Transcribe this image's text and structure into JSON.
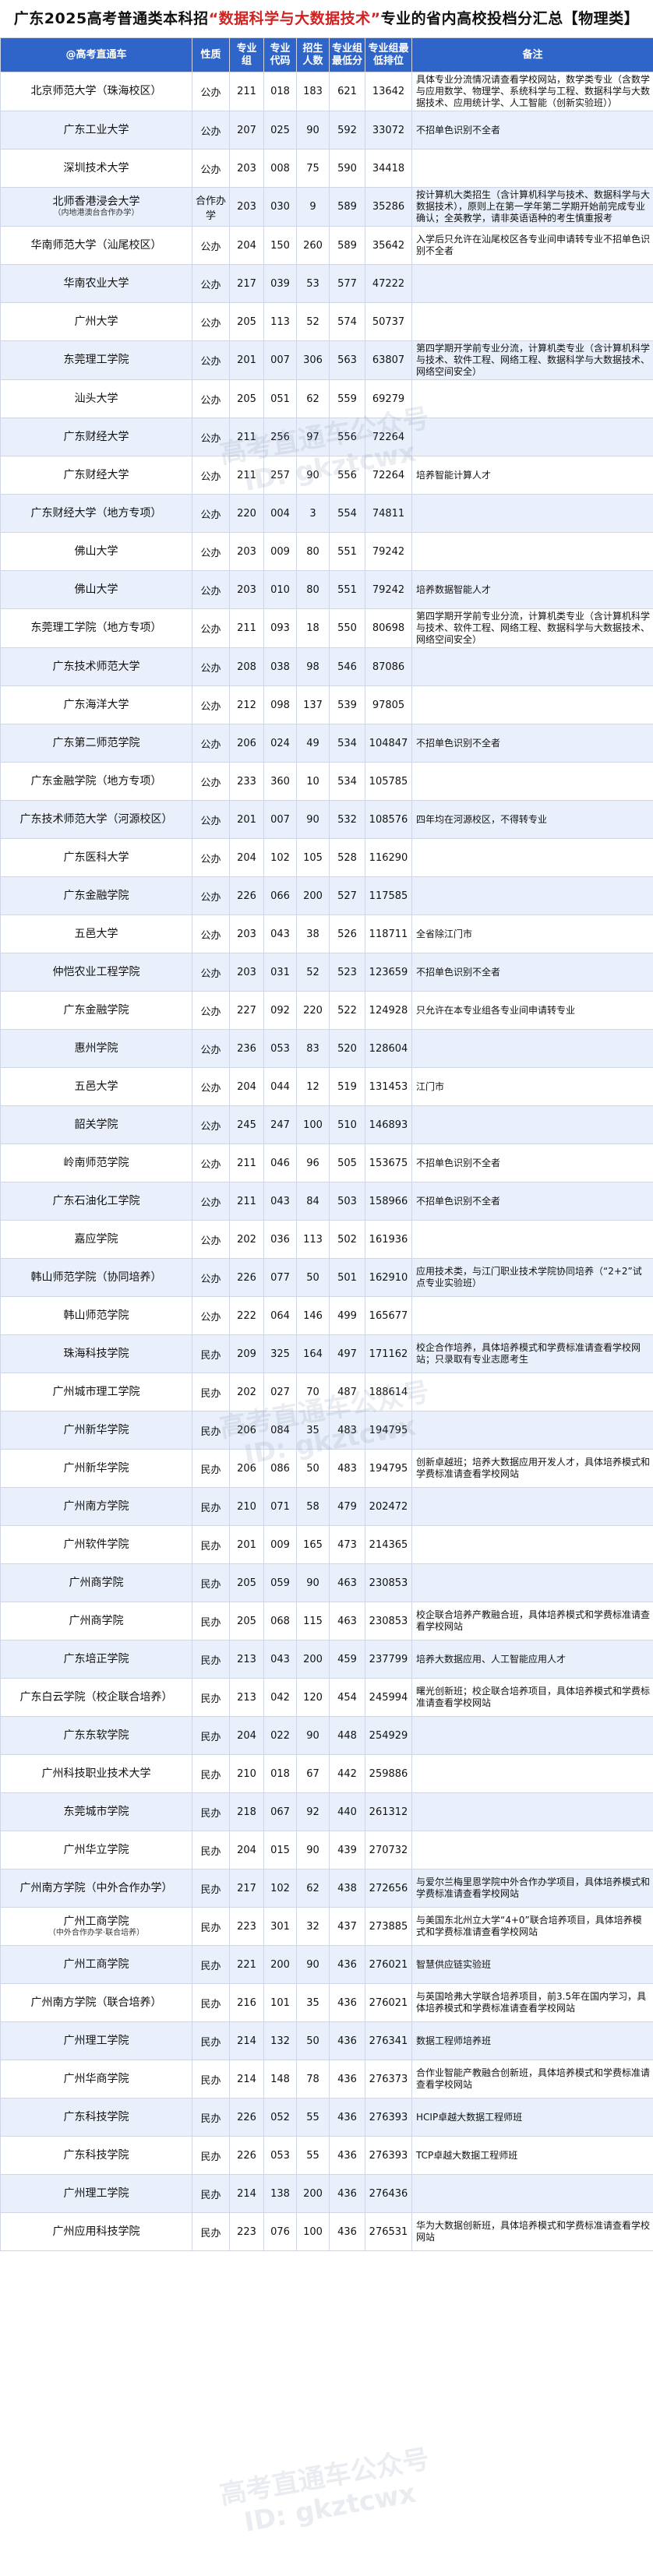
{
  "title": {
    "prefix": "广东2025高考普通类本科招",
    "highlight": "“数据科学与大数据技术”",
    "suffix": "专业的省内高校投档分汇总【物理类】"
  },
  "columns": [
    "@高考直通车",
    "性质",
    "专业组",
    "专业代码",
    "招生人数",
    "专业组最低分",
    "专业组最低排位",
    "备注"
  ],
  "watermark": [
    "高考直通车公众号",
    "ID: gkztcwx"
  ],
  "rows": [
    {
      "school": "北京师范大学（珠海校区）",
      "sub": "",
      "type": "公办",
      "group": "211",
      "code": "018",
      "count": "183",
      "score": "621",
      "rank": "13642",
      "note": "具体专业分流情况请查看学校网站，数学类专业（含数学与应用数学、物理学、系统科学与工程、数据科学与大数据技术、应用统计学、人工智能（创新实验班））"
    },
    {
      "school": "广东工业大学",
      "sub": "",
      "type": "公办",
      "group": "207",
      "code": "025",
      "count": "90",
      "score": "592",
      "rank": "33072",
      "note": "不招单色识别不全者"
    },
    {
      "school": "深圳技术大学",
      "sub": "",
      "type": "公办",
      "group": "203",
      "code": "008",
      "count": "75",
      "score": "590",
      "rank": "34418",
      "note": ""
    },
    {
      "school": "北师香港浸会大学",
      "sub": "（内地港澳台合作办学）",
      "type": "合作办学",
      "group": "203",
      "code": "030",
      "count": "9",
      "score": "589",
      "rank": "35286",
      "note": "按计算机大类招生（含计算机科学与技术、数据科学与大数据技术），原则上在第一学年第二学期开始前完成专业确认；全英教学，请非英语语种的考生慎重报考"
    },
    {
      "school": "华南师范大学（汕尾校区）",
      "sub": "",
      "type": "公办",
      "group": "204",
      "code": "150",
      "count": "260",
      "score": "589",
      "rank": "35642",
      "note": "入学后只允许在汕尾校区各专业间申请转专业不招单色识别不全者"
    },
    {
      "school": "华南农业大学",
      "sub": "",
      "type": "公办",
      "group": "217",
      "code": "039",
      "count": "53",
      "score": "577",
      "rank": "47222",
      "note": ""
    },
    {
      "school": "广州大学",
      "sub": "",
      "type": "公办",
      "group": "205",
      "code": "113",
      "count": "52",
      "score": "574",
      "rank": "50737",
      "note": ""
    },
    {
      "school": "东莞理工学院",
      "sub": "",
      "type": "公办",
      "group": "201",
      "code": "007",
      "count": "306",
      "score": "563",
      "rank": "63807",
      "note": "第四学期开学前专业分流，计算机类专业（含计算机科学与技术、软件工程、网络工程、数据科学与大数据技术、网络空间安全）"
    },
    {
      "school": "汕头大学",
      "sub": "",
      "type": "公办",
      "group": "205",
      "code": "051",
      "count": "62",
      "score": "559",
      "rank": "69279",
      "note": ""
    },
    {
      "school": "广东财经大学",
      "sub": "",
      "type": "公办",
      "group": "211",
      "code": "256",
      "count": "97",
      "score": "556",
      "rank": "72264",
      "note": ""
    },
    {
      "school": "广东财经大学",
      "sub": "",
      "type": "公办",
      "group": "211",
      "code": "257",
      "count": "90",
      "score": "556",
      "rank": "72264",
      "note": "培养智能计算人才"
    },
    {
      "school": "广东财经大学（地方专项）",
      "sub": "",
      "type": "公办",
      "group": "220",
      "code": "004",
      "count": "3",
      "score": "554",
      "rank": "74811",
      "note": ""
    },
    {
      "school": "佛山大学",
      "sub": "",
      "type": "公办",
      "group": "203",
      "code": "009",
      "count": "80",
      "score": "551",
      "rank": "79242",
      "note": ""
    },
    {
      "school": "佛山大学",
      "sub": "",
      "type": "公办",
      "group": "203",
      "code": "010",
      "count": "80",
      "score": "551",
      "rank": "79242",
      "note": "培养数据智能人才"
    },
    {
      "school": "东莞理工学院（地方专项）",
      "sub": "",
      "type": "公办",
      "group": "211",
      "code": "093",
      "count": "18",
      "score": "550",
      "rank": "80698",
      "note": "第四学期开学前专业分流，计算机类专业（含计算机科学与技术、软件工程、网络工程、数据科学与大数据技术、网络空间安全）"
    },
    {
      "school": "广东技术师范大学",
      "sub": "",
      "type": "公办",
      "group": "208",
      "code": "038",
      "count": "98",
      "score": "546",
      "rank": "87086",
      "note": ""
    },
    {
      "school": "广东海洋大学",
      "sub": "",
      "type": "公办",
      "group": "212",
      "code": "098",
      "count": "137",
      "score": "539",
      "rank": "97805",
      "note": ""
    },
    {
      "school": "广东第二师范学院",
      "sub": "",
      "type": "公办",
      "group": "206",
      "code": "024",
      "count": "49",
      "score": "534",
      "rank": "104847",
      "note": "不招单色识别不全者"
    },
    {
      "school": "广东金融学院（地方专项）",
      "sub": "",
      "type": "公办",
      "group": "233",
      "code": "360",
      "count": "10",
      "score": "534",
      "rank": "105785",
      "note": ""
    },
    {
      "school": "广东技术师范大学（河源校区）",
      "sub": "",
      "type": "公办",
      "group": "201",
      "code": "007",
      "count": "90",
      "score": "532",
      "rank": "108576",
      "note": "四年均在河源校区，不得转专业"
    },
    {
      "school": "广东医科大学",
      "sub": "",
      "type": "公办",
      "group": "204",
      "code": "102",
      "count": "105",
      "score": "528",
      "rank": "116290",
      "note": ""
    },
    {
      "school": "广东金融学院",
      "sub": "",
      "type": "公办",
      "group": "226",
      "code": "066",
      "count": "200",
      "score": "527",
      "rank": "117585",
      "note": ""
    },
    {
      "school": "五邑大学",
      "sub": "",
      "type": "公办",
      "group": "203",
      "code": "043",
      "count": "38",
      "score": "526",
      "rank": "118711",
      "note": "全省除江门市"
    },
    {
      "school": "仲恺农业工程学院",
      "sub": "",
      "type": "公办",
      "group": "203",
      "code": "031",
      "count": "52",
      "score": "523",
      "rank": "123659",
      "note": "不招单色识别不全者"
    },
    {
      "school": "广东金融学院",
      "sub": "",
      "type": "公办",
      "group": "227",
      "code": "092",
      "count": "220",
      "score": "522",
      "rank": "124928",
      "note": "只允许在本专业组各专业间申请转专业"
    },
    {
      "school": "惠州学院",
      "sub": "",
      "type": "公办",
      "group": "236",
      "code": "053",
      "count": "83",
      "score": "520",
      "rank": "128604",
      "note": ""
    },
    {
      "school": "五邑大学",
      "sub": "",
      "type": "公办",
      "group": "204",
      "code": "044",
      "count": "12",
      "score": "519",
      "rank": "131453",
      "note": "江门市"
    },
    {
      "school": "韶关学院",
      "sub": "",
      "type": "公办",
      "group": "245",
      "code": "247",
      "count": "100",
      "score": "510",
      "rank": "146893",
      "note": ""
    },
    {
      "school": "岭南师范学院",
      "sub": "",
      "type": "公办",
      "group": "211",
      "code": "046",
      "count": "96",
      "score": "505",
      "rank": "153675",
      "note": "不招单色识别不全者"
    },
    {
      "school": "广东石油化工学院",
      "sub": "",
      "type": "公办",
      "group": "211",
      "code": "043",
      "count": "84",
      "score": "503",
      "rank": "158966",
      "note": "不招单色识别不全者"
    },
    {
      "school": "嘉应学院",
      "sub": "",
      "type": "公办",
      "group": "202",
      "code": "036",
      "count": "113",
      "score": "502",
      "rank": "161936",
      "note": ""
    },
    {
      "school": "韩山师范学院（协同培养）",
      "sub": "",
      "type": "公办",
      "group": "226",
      "code": "077",
      "count": "50",
      "score": "501",
      "rank": "162910",
      "note": "应用技术类，与江门职业技术学院协同培养（“2+2”试点专业实验班）"
    },
    {
      "school": "韩山师范学院",
      "sub": "",
      "type": "公办",
      "group": "222",
      "code": "064",
      "count": "146",
      "score": "499",
      "rank": "165677",
      "note": ""
    },
    {
      "school": "珠海科技学院",
      "sub": "",
      "type": "民办",
      "group": "209",
      "code": "325",
      "count": "164",
      "score": "497",
      "rank": "171162",
      "note": "校企合作培养，具体培养模式和学费标准请查看学校网站；只录取有专业志愿考生"
    },
    {
      "school": "广州城市理工学院",
      "sub": "",
      "type": "民办",
      "group": "202",
      "code": "027",
      "count": "70",
      "score": "487",
      "rank": "188614",
      "note": ""
    },
    {
      "school": "广州新华学院",
      "sub": "",
      "type": "民办",
      "group": "206",
      "code": "084",
      "count": "35",
      "score": "483",
      "rank": "194795",
      "note": ""
    },
    {
      "school": "广州新华学院",
      "sub": "",
      "type": "民办",
      "group": "206",
      "code": "086",
      "count": "50",
      "score": "483",
      "rank": "194795",
      "note": "创新卓越班；培养大数据应用开发人才，具体培养模式和学费标准请查看学校网站"
    },
    {
      "school": "广州南方学院",
      "sub": "",
      "type": "民办",
      "group": "210",
      "code": "071",
      "count": "58",
      "score": "479",
      "rank": "202472",
      "note": ""
    },
    {
      "school": "广州软件学院",
      "sub": "",
      "type": "民办",
      "group": "201",
      "code": "009",
      "count": "165",
      "score": "473",
      "rank": "214365",
      "note": ""
    },
    {
      "school": "广州商学院",
      "sub": "",
      "type": "民办",
      "group": "205",
      "code": "059",
      "count": "90",
      "score": "463",
      "rank": "230853",
      "note": ""
    },
    {
      "school": "广州商学院",
      "sub": "",
      "type": "民办",
      "group": "205",
      "code": "068",
      "count": "115",
      "score": "463",
      "rank": "230853",
      "note": "校企联合培养产教融合班，具体培养模式和学费标准请查看学校网站"
    },
    {
      "school": "广东培正学院",
      "sub": "",
      "type": "民办",
      "group": "213",
      "code": "043",
      "count": "200",
      "score": "459",
      "rank": "237799",
      "note": "培养大数据应用、人工智能应用人才"
    },
    {
      "school": "广东白云学院（校企联合培养）",
      "sub": "",
      "type": "民办",
      "group": "213",
      "code": "042",
      "count": "120",
      "score": "454",
      "rank": "245994",
      "note": "曙光创新班；校企联合培养项目，具体培养模式和学费标准请查看学校网站"
    },
    {
      "school": "广东东软学院",
      "sub": "",
      "type": "民办",
      "group": "204",
      "code": "022",
      "count": "90",
      "score": "448",
      "rank": "254929",
      "note": ""
    },
    {
      "school": "广州科技职业技术大学",
      "sub": "",
      "type": "民办",
      "group": "210",
      "code": "018",
      "count": "67",
      "score": "442",
      "rank": "259886",
      "note": ""
    },
    {
      "school": "东莞城市学院",
      "sub": "",
      "type": "民办",
      "group": "218",
      "code": "067",
      "count": "92",
      "score": "440",
      "rank": "261312",
      "note": ""
    },
    {
      "school": "广州华立学院",
      "sub": "",
      "type": "民办",
      "group": "204",
      "code": "015",
      "count": "90",
      "score": "439",
      "rank": "270732",
      "note": ""
    },
    {
      "school": "广州南方学院（中外合作办学）",
      "sub": "",
      "type": "民办",
      "group": "217",
      "code": "102",
      "count": "62",
      "score": "438",
      "rank": "272656",
      "note": "与爱尔兰梅里恩学院中外合作办学项目，具体培养模式和学费标准请查看学校网站"
    },
    {
      "school": "广州工商学院",
      "sub": "（中外合作办学·联合培养）",
      "type": "民办",
      "group": "223",
      "code": "301",
      "count": "32",
      "score": "437",
      "rank": "273885",
      "note": "与美国东北州立大学“4+0”联合培养项目，具体培养模式和学费标准请查看学校网站"
    },
    {
      "school": "广州工商学院",
      "sub": "",
      "type": "民办",
      "group": "221",
      "code": "200",
      "count": "90",
      "score": "436",
      "rank": "276021",
      "note": "智慧供应链实验班"
    },
    {
      "school": "广州南方学院（联合培养）",
      "sub": "",
      "type": "民办",
      "group": "216",
      "code": "101",
      "count": "35",
      "score": "436",
      "rank": "276021",
      "note": "与英国哈弗大学联合培养项目，前3.5年在国内学习，具体培养模式和学费标准请查看学校网站"
    },
    {
      "school": "广州理工学院",
      "sub": "",
      "type": "民办",
      "group": "214",
      "code": "132",
      "count": "50",
      "score": "436",
      "rank": "276341",
      "note": "数据工程师培养班"
    },
    {
      "school": "广州华商学院",
      "sub": "",
      "type": "民办",
      "group": "214",
      "code": "148",
      "count": "78",
      "score": "436",
      "rank": "276373",
      "note": "合作业智能产教融合创新班，具体培养模式和学费标准请查看学校网站"
    },
    {
      "school": "广东科技学院",
      "sub": "",
      "type": "民办",
      "group": "226",
      "code": "052",
      "count": "55",
      "score": "436",
      "rank": "276393",
      "note": "HCIP卓越大数据工程师班"
    },
    {
      "school": "广东科技学院",
      "sub": "",
      "type": "民办",
      "group": "226",
      "code": "053",
      "count": "55",
      "score": "436",
      "rank": "276393",
      "note": "TCP卓越大数据工程师班"
    },
    {
      "school": "广州理工学院",
      "sub": "",
      "type": "民办",
      "group": "214",
      "code": "138",
      "count": "200",
      "score": "436",
      "rank": "276436",
      "note": ""
    },
    {
      "school": "广州应用科技学院",
      "sub": "",
      "type": "民办",
      "group": "223",
      "code": "076",
      "count": "100",
      "score": "436",
      "rank": "276531",
      "note": "华为大数据创新班，具体培养模式和学费标准请查看学校网站"
    }
  ]
}
